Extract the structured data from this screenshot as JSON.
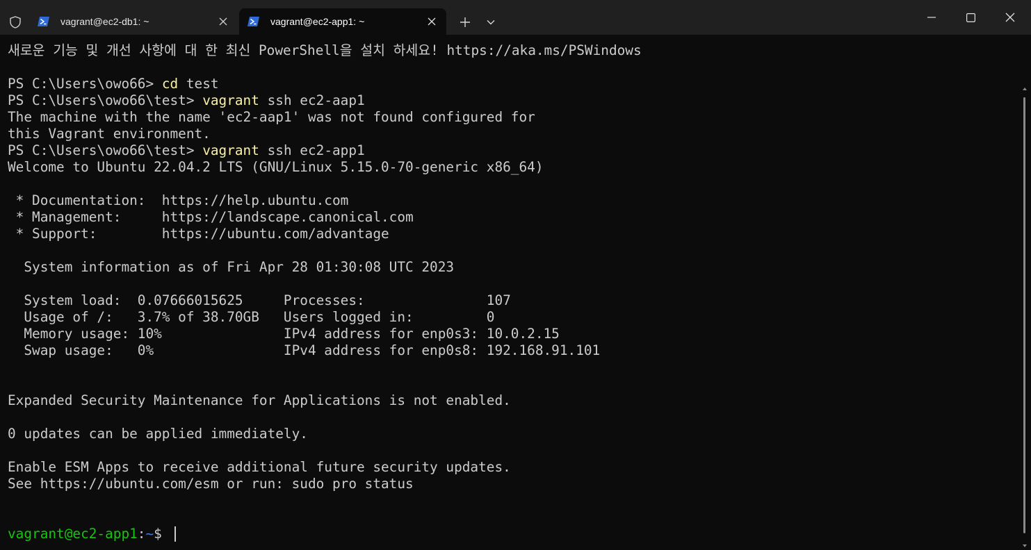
{
  "tabs": [
    {
      "title": "vagrant@ec2-db1: ~",
      "active": false
    },
    {
      "title": "vagrant@ec2-app1: ~",
      "active": true
    }
  ],
  "colors": {
    "terminal_bg": "#0c0c0c",
    "text": "#cccccc",
    "command": "#f9f1a5",
    "prompt_user": "#16c60c",
    "prompt_path": "#3b78ff",
    "titlebar_bg": "#202020"
  },
  "icons": {
    "shield": "shield-icon",
    "powershell": "powershell-icon",
    "close": "close-icon",
    "new_tab": "plus-icon",
    "dropdown": "chevron-down-icon",
    "minimize": "minimize-icon",
    "maximize": "maximize-icon",
    "window_close": "window-close-icon"
  },
  "terminal": {
    "banner": "새로운 기능 및 개선 사항에 대 한 최신 PowerShell을 설치 하세요! https://aka.ms/PSWindows",
    "cmd1": {
      "prompt": "PS C:\\Users\\owo66> ",
      "command": "cd",
      "args": " test"
    },
    "cmd2": {
      "prompt": "PS C:\\Users\\owo66\\test> ",
      "command": "vagrant",
      "args": " ssh ec2-aap1"
    },
    "err1": "The machine with the name 'ec2-aap1' was not found configured for",
    "err2": "this Vagrant environment.",
    "cmd3": {
      "prompt": "PS C:\\Users\\owo66\\test> ",
      "command": "vagrant",
      "args": " ssh ec2-app1"
    },
    "welcome": "Welcome to Ubuntu 22.04.2 LTS (GNU/Linux 5.15.0-70-generic x86_64)",
    "doc": " * Documentation:  https://help.ubuntu.com",
    "mgmt": " * Management:     https://landscape.canonical.com",
    "support": " * Support:        https://ubuntu.com/advantage",
    "sysinfo": "  System information as of Fri Apr 28 01:30:08 UTC 2023",
    "stat1": "  System load:  0.07666015625     Processes:               107",
    "stat2": "  Usage of /:   3.7% of 38.70GB   Users logged in:         0",
    "stat3": "  Memory usage: 10%               IPv4 address for enp0s3: 10.0.2.15",
    "stat4": "  Swap usage:   0%                IPv4 address for enp0s8: 192.168.91.101",
    "esm": "Expanded Security Maintenance for Applications is not enabled.",
    "updates": "0 updates can be applied immediately.",
    "enable_esm": "Enable ESM Apps to receive additional future security updates.",
    "see_esm": "See https://ubuntu.com/esm or run: sudo pro status",
    "final_prompt": {
      "user_host": "vagrant@ec2-app1",
      "sep": ":",
      "path": "~",
      "symbol": "$ "
    }
  }
}
